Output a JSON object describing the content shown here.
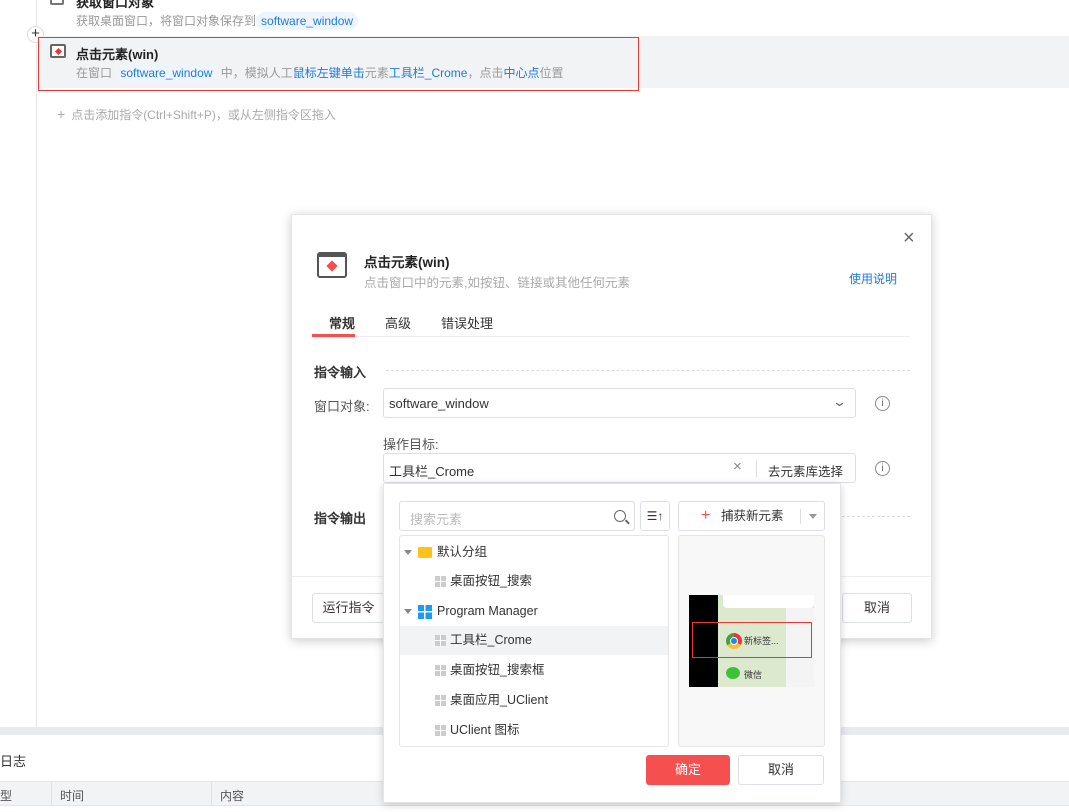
{
  "flow": {
    "step1": {
      "title": "获取窗口对象",
      "desc_prefix": "获取桌面窗口，将窗口对象保存到",
      "var": "software_window"
    },
    "step2": {
      "title": "点击元素(win)",
      "p1": "在窗口",
      "var": "software_window",
      "p2": "中，模拟人工",
      "action": "鼠标左键单击",
      "p3": "元素",
      "element": "工具栏_Crome",
      "p4": "，点击",
      "pos": "中心点",
      "p5": "位置"
    },
    "add_hint": "点击添加指令(Ctrl+Shift+P)，或从左侧指令区拖入",
    "plus": "+"
  },
  "dialog": {
    "title": "点击元素(win)",
    "subtitle": "点击窗口中的元素,如按钮、链接或其他任何元素",
    "help": "使用说明",
    "close": "×",
    "tabs": [
      "常规",
      "高级",
      "错误处理"
    ],
    "section_input": "指令输入",
    "window_label": "窗口对象:",
    "window_value": "software_window",
    "target_label": "操作目标:",
    "target_value": "工具栏_Crome",
    "pick_lib": "去元素库选择",
    "section_output": "指令输出",
    "run": "运行指令",
    "cancel": "取消"
  },
  "picker": {
    "search_placeholder": "搜索元素",
    "capture": "捕获新元素",
    "tree": [
      {
        "label": "默认分组",
        "type": "folder"
      },
      {
        "label": "桌面按钮_搜索",
        "type": "element"
      },
      {
        "label": "Program Manager",
        "type": "window"
      },
      {
        "label": "工具栏_Crome",
        "type": "element",
        "selected": true
      },
      {
        "label": "桌面按钮_搜索框",
        "type": "element"
      },
      {
        "label": "桌面应用_UClient",
        "type": "element"
      },
      {
        "label": "UClient 图标",
        "type": "element"
      }
    ],
    "preview": {
      "tab_label": "新标签...",
      "wechat": "微信"
    },
    "ok": "确定",
    "cancel": "取消"
  },
  "log": {
    "title": "日志",
    "columns": [
      "型",
      "时间",
      "内容"
    ]
  },
  "colors": {
    "accent": "#f5504f",
    "link": "#1f7ae0"
  }
}
